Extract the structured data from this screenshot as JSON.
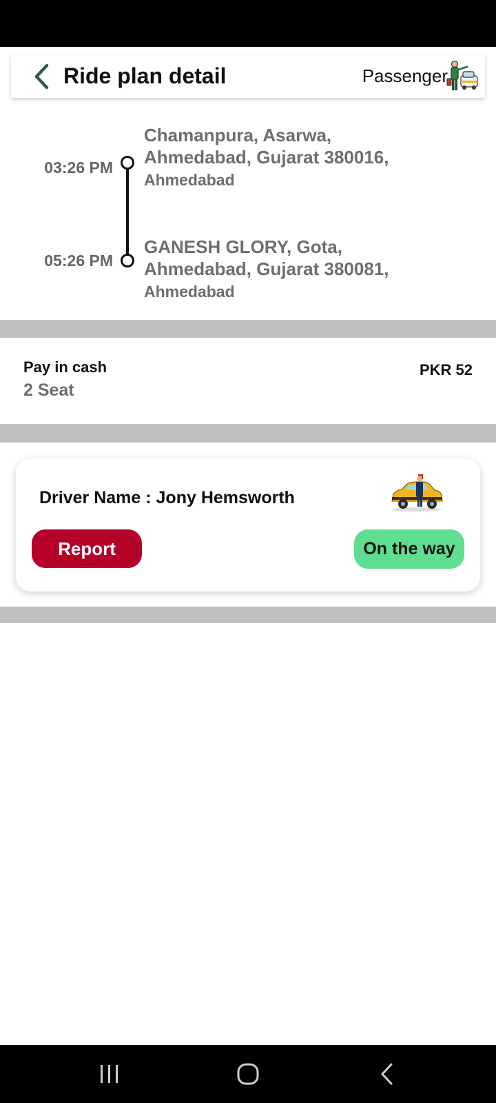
{
  "header": {
    "title": "Ride plan detail",
    "role_label": "Passenger",
    "back_icon": "chevron-left-icon",
    "role_icon": "passenger-taxi-icon",
    "accent_color": "#2e5e3a"
  },
  "route": {
    "stops": [
      {
        "time": "03:26 PM",
        "address_line1": "Chamanpura, Asarwa,",
        "address_line2": "Ahmedabad, Gujarat 380016,",
        "city": "Ahmedabad"
      },
      {
        "time": "05:26 PM",
        "address_line1": "GANESH GLORY, Gota,",
        "address_line2": "Ahmedabad, Gujarat 380081,",
        "city": "Ahmedabad"
      }
    ]
  },
  "payment": {
    "method": "Pay in cash",
    "seats": "2 Seat",
    "price": "PKR 52"
  },
  "driver": {
    "name_label": "Driver Name : Jony Hemsworth",
    "icon": "driver-car-icon",
    "report_label": "Report",
    "status_label": "On the way",
    "report_color": "#b5002a",
    "status_color": "#5fde92"
  },
  "nav": {
    "recents_icon": "recents-icon",
    "home_icon": "home-icon",
    "back_icon": "back-icon"
  }
}
